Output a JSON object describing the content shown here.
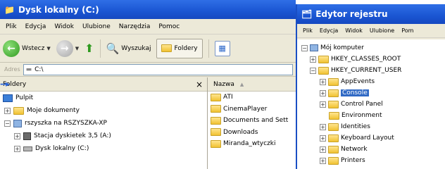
{
  "explorer": {
    "title": "Dysk lokalny (C:)",
    "menu": [
      "Plik",
      "Edycja",
      "Widok",
      "Ulubione",
      "Narzędzia",
      "Pomoc"
    ],
    "toolbar": {
      "back": "Wstecz",
      "search": "Wyszukaj",
      "folders": "Foldery"
    },
    "address": {
      "label": "Adres",
      "value": "C:\\"
    },
    "left_pane": {
      "header": "Foldery",
      "close": "×",
      "tree": [
        "Pulpit",
        "Moje dokumenty",
        "rszyszka na RSZYSZKA-XP",
        "Stacja dyskietek 3,5 (A:)",
        "Dysk lokalny (C:)"
      ]
    },
    "right_pane": {
      "column": "Nazwa",
      "sort_indicator": "▲",
      "files": [
        "ATI",
        "CinemaPlayer",
        "Documents and Sett",
        "Downloads",
        "Miranda_wtyczki"
      ]
    }
  },
  "regedit": {
    "title": "Edytor rejestru",
    "menu": [
      "Plik",
      "Edycja",
      "Widok",
      "Ulubione",
      "Pom"
    ],
    "tree": {
      "root": "Mój komputer",
      "hkcr": "HKEY_CLASSES_ROOT",
      "hkcu": "HKEY_CURRENT_USER",
      "children": [
        "AppEvents",
        "Console",
        "Control Panel",
        "Environment",
        "Identities",
        "Keyboard Layout",
        "Network",
        "Printers"
      ],
      "selected": "Console"
    }
  },
  "colors": {
    "titlebar": "#1a55d2",
    "selection": "#316ac5"
  }
}
